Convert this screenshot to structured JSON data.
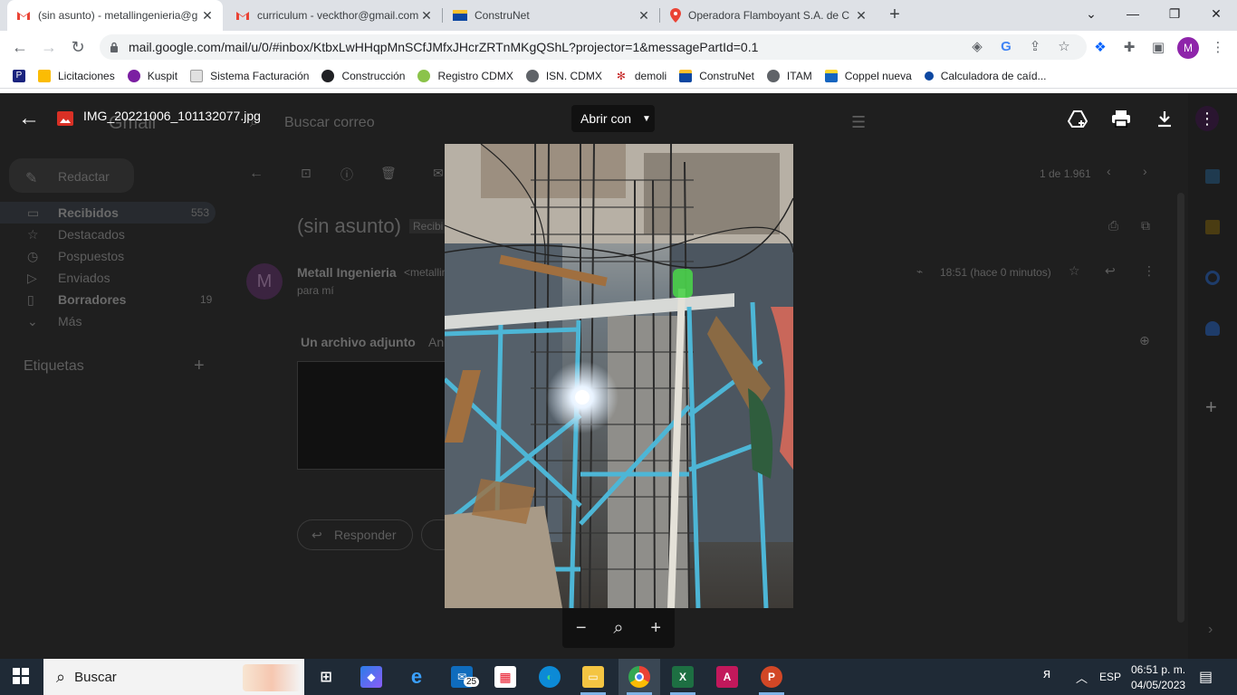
{
  "browser": {
    "tabs": [
      {
        "title": "(sin asunto) - metallingenieria@g",
        "icon": "gmail-icon",
        "active": true
      },
      {
        "title": "curriculum - veckthor@gmail.com",
        "icon": "gmail-icon",
        "active": false
      },
      {
        "title": "ConstruNet",
        "icon": "construnet-icon",
        "active": false
      },
      {
        "title": "Operadora Flamboyant S.A. de C",
        "icon": "maps-pin-icon",
        "active": false
      }
    ],
    "new_tab": "+",
    "url": "mail.google.com/mail/u/0/#inbox/KtbxLwHHqpMnSCfJMfxJHcrZRTnMKgQShL?projector=1&messagePartId=0.1",
    "profile_initial": "M",
    "bookmarks": [
      {
        "label": "Licitaciones",
        "color": "#fbbc04"
      },
      {
        "label": "Kuspit",
        "color": "#7b1fa2"
      },
      {
        "label": "Sistema Facturación",
        "color": "#9e9e9e"
      },
      {
        "label": "Construcción",
        "color": "#202124"
      },
      {
        "label": "Registro CDMX",
        "color": "#8bc34a"
      },
      {
        "label": "ISN. CDMX",
        "color": "#5f6368"
      },
      {
        "label": "demoli",
        "color": "#c62828"
      },
      {
        "label": "ConstruNet",
        "color": "#0d47a1"
      },
      {
        "label": "ITAM",
        "color": "#5f6368"
      },
      {
        "label": "Coppel nueva",
        "color": "#1565c0"
      },
      {
        "label": "Calculadora de caíd...",
        "color": "#0d47a1"
      }
    ]
  },
  "gmail": {
    "logo": "Gmail",
    "search_placeholder": "Buscar correo",
    "compose": "Redactar",
    "nav": [
      {
        "label": "Recibidos",
        "count": "553",
        "bold": true
      },
      {
        "label": "Destacados",
        "count": "",
        "bold": false
      },
      {
        "label": "Pospuestos",
        "count": "",
        "bold": false
      },
      {
        "label": "Enviados",
        "count": "",
        "bold": false
      },
      {
        "label": "Borradores",
        "count": "19",
        "bold": true
      },
      {
        "label": "Más",
        "count": "",
        "bold": false
      }
    ],
    "labels_heading": "Etiquetas",
    "pager": "1 de 1.961",
    "subject": "(sin asunto)",
    "subject_tag": "Recibi",
    "sender": "Metall Ingenieria",
    "sender_email": "<metallin",
    "to": "para mí",
    "time": "18:51 (hace 0 minutos)",
    "attachment_label": "Un archivo adjunto",
    "attachment_more": "An",
    "reply": "Responder"
  },
  "viewer": {
    "filename": "IMG_20221006_101132077.jpg",
    "open_with": "Abrir con",
    "zoom_out": "−",
    "zoom_reset": "⌕",
    "zoom_in": "+"
  },
  "taskbar": {
    "search": "Buscar",
    "mail_badge": "25",
    "language": "ESP",
    "time": "06:51 p. m.",
    "date": "04/05/2023"
  }
}
